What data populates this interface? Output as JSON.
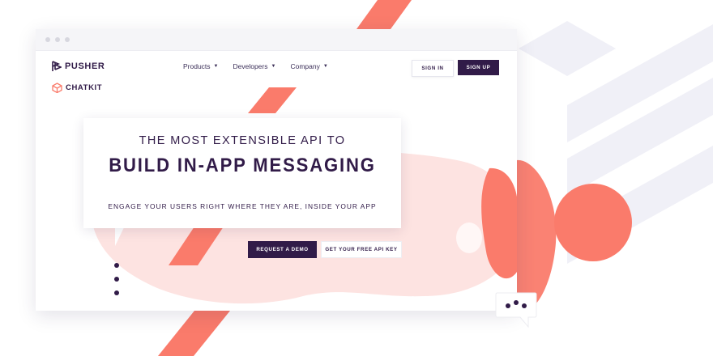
{
  "brand": {
    "pusher_name": "PUSHER",
    "chatkit_name": "CHATKIT",
    "pusher_icon": "pusher-logo-icon",
    "chatkit_icon": "chatkit-logo-icon"
  },
  "nav": {
    "items": [
      {
        "label": "Products",
        "icon": "chevron-down-icon"
      },
      {
        "label": "Developers",
        "icon": "chevron-down-icon"
      },
      {
        "label": "Company",
        "icon": "chevron-down-icon"
      }
    ],
    "sign_in": "SIGN IN",
    "sign_up": "SIGN UP"
  },
  "hero": {
    "line1": "THE MOST EXTENSIBLE API TO",
    "line2": "BUILD IN-APP MESSAGING",
    "subtitle": "ENGAGE YOUR USERS RIGHT WHERE THEY ARE, INSIDE YOUR APP"
  },
  "cta": {
    "demo": "REQUEST A DEMO",
    "api_key": "GET YOUR FREE API KEY"
  },
  "colors": {
    "brand_dark": "#311b48",
    "accent_coral": "#fa7b6b",
    "blob_pink": "#fde3e1",
    "background_stripes": "#f0f0f7"
  },
  "decorations": {
    "typing_indicator_icon": "chat-bubble-typing-icon",
    "window_controls_icon": "window-dots-icon"
  }
}
